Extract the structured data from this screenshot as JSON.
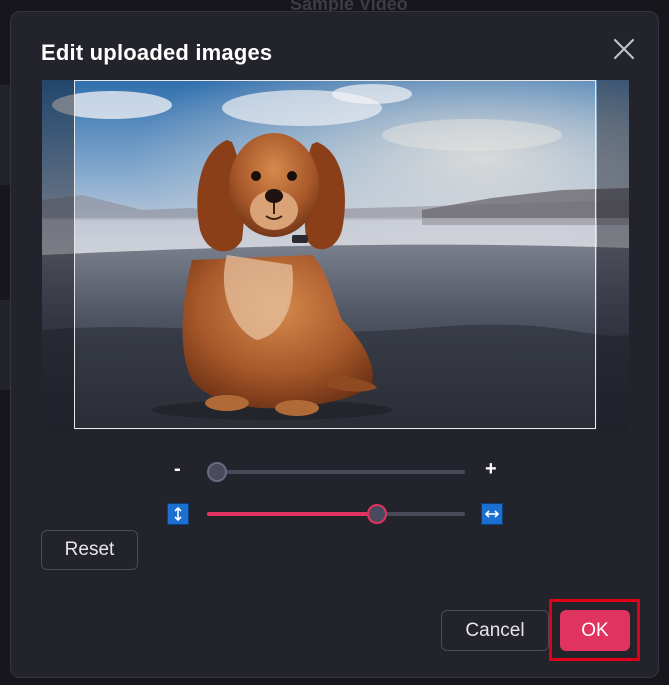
{
  "backdrop": {
    "title": "Sample Video"
  },
  "dialog": {
    "title": "Edit uploaded images",
    "close_icon": "close-icon"
  },
  "image": {
    "subject": "dog-photo"
  },
  "zoom": {
    "minus_label": "-",
    "plus_label": "+",
    "value": 0.04
  },
  "aspect": {
    "value": 0.66,
    "vertical_icon": "vertical-arrows-icon",
    "horizontal_icon": "horizontal-arrows-icon"
  },
  "buttons": {
    "reset": "Reset",
    "cancel": "Cancel",
    "ok": "OK"
  },
  "colors": {
    "accent": "#e0335f",
    "dialog_bg": "#23232c",
    "highlight": "#e1001a",
    "icon_blue": "#1a6fd1"
  }
}
